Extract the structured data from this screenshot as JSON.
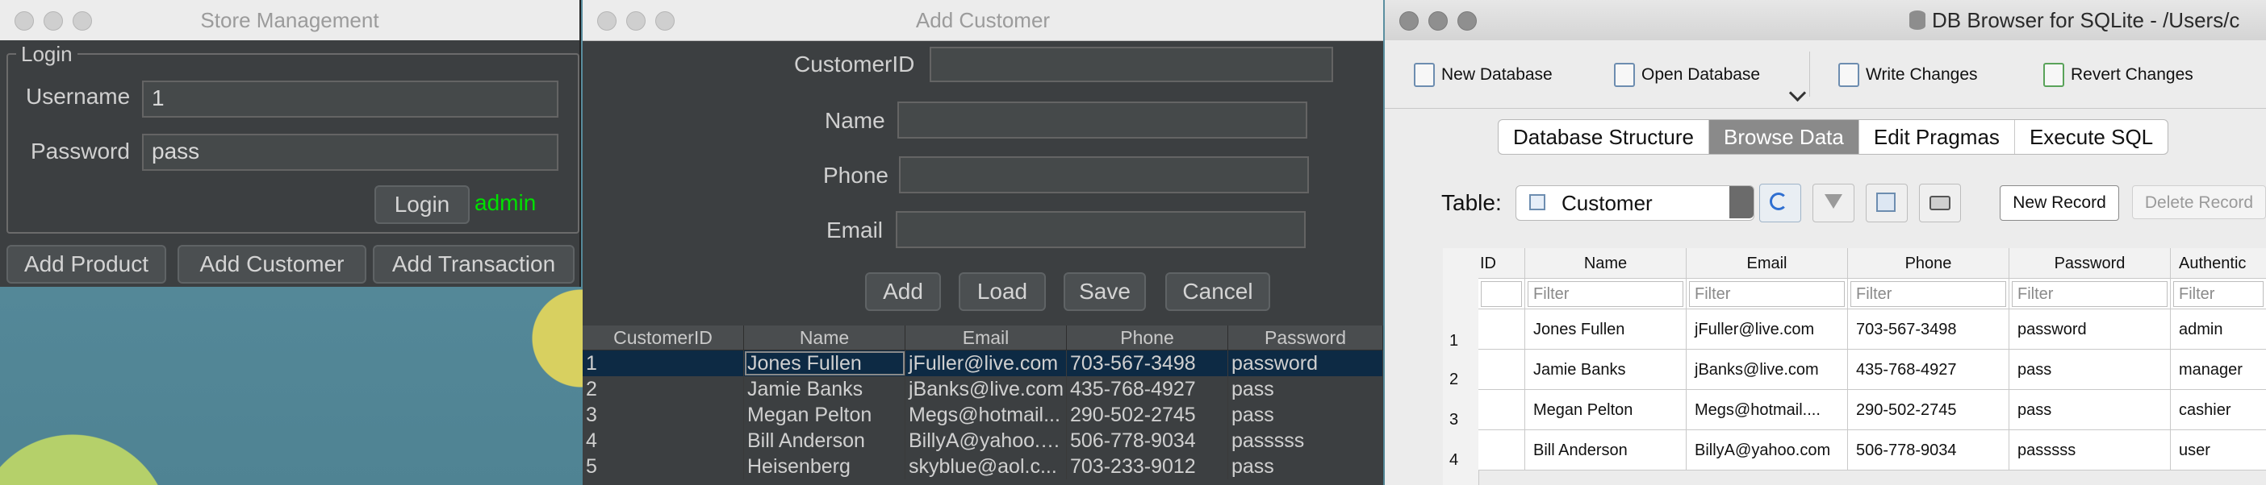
{
  "store": {
    "title": "Store Management",
    "legend": "Login",
    "username_label": "Username",
    "username_value": "1",
    "password_label": "Password",
    "password_value": "pass",
    "login_button": "Login",
    "role_text": "admin",
    "role_color": "#00e000",
    "buttons": [
      "Add Product",
      "Add Customer",
      "Add Transaction"
    ]
  },
  "add_customer": {
    "title": "Add Customer",
    "labels": {
      "id": "CustomerID",
      "name": "Name",
      "phone": "Phone",
      "email": "Email"
    },
    "buttons": [
      "Add",
      "Load",
      "Save",
      "Cancel"
    ],
    "columns": [
      "CustomerID",
      "Name",
      "Email",
      "Phone",
      "Password"
    ],
    "rows": [
      [
        "1",
        "Jones Fullen",
        "jFuller@live.com",
        "703-567-3498",
        "password"
      ],
      [
        "2",
        "Jamie Banks",
        "jBanks@live.com",
        "435-768-4927",
        "pass"
      ],
      [
        "3",
        "Megan Pelton",
        "Megs@hotmail...",
        "290-502-2745",
        "pass"
      ],
      [
        "4",
        "Bill Anderson",
        "BillyA@yahoo.c...",
        "506-778-9034",
        "passsss"
      ],
      [
        "5",
        "Heisenberg",
        "skyblue@aol.c...",
        "703-233-9012",
        "pass"
      ]
    ]
  },
  "dbbrowser": {
    "title": "DB Browser for SQLite - /Users/c",
    "toolbar": [
      "New Database",
      "Open Database",
      "Write Changes",
      "Revert Changes"
    ],
    "tabs": [
      "Database Structure",
      "Browse Data",
      "Edit Pragmas",
      "Execute SQL"
    ],
    "active_tab": "Browse Data",
    "table_label": "Table:",
    "table_value": "Customer",
    "new_record": "New Record",
    "delete_record": "Delete Record",
    "columns": [
      "ID",
      "Name",
      "Email",
      "Phone",
      "Password",
      "Authentic"
    ],
    "filter_placeholder": "Filter",
    "rows": [
      [
        "1",
        "",
        "Jones Fullen",
        "jFuller@live.com",
        "703-567-3498",
        "password",
        "admin"
      ],
      [
        "2",
        "",
        "Jamie Banks",
        "jBanks@live.com",
        "435-768-4927",
        "pass",
        "manager"
      ],
      [
        "3",
        "",
        "Megan Pelton",
        "Megs@hotmail....",
        "290-502-2745",
        "pass",
        "cashier"
      ],
      [
        "4",
        "",
        "Bill Anderson",
        "BillyA@yahoo.com",
        "506-778-9034",
        "passsss",
        "user"
      ]
    ]
  }
}
